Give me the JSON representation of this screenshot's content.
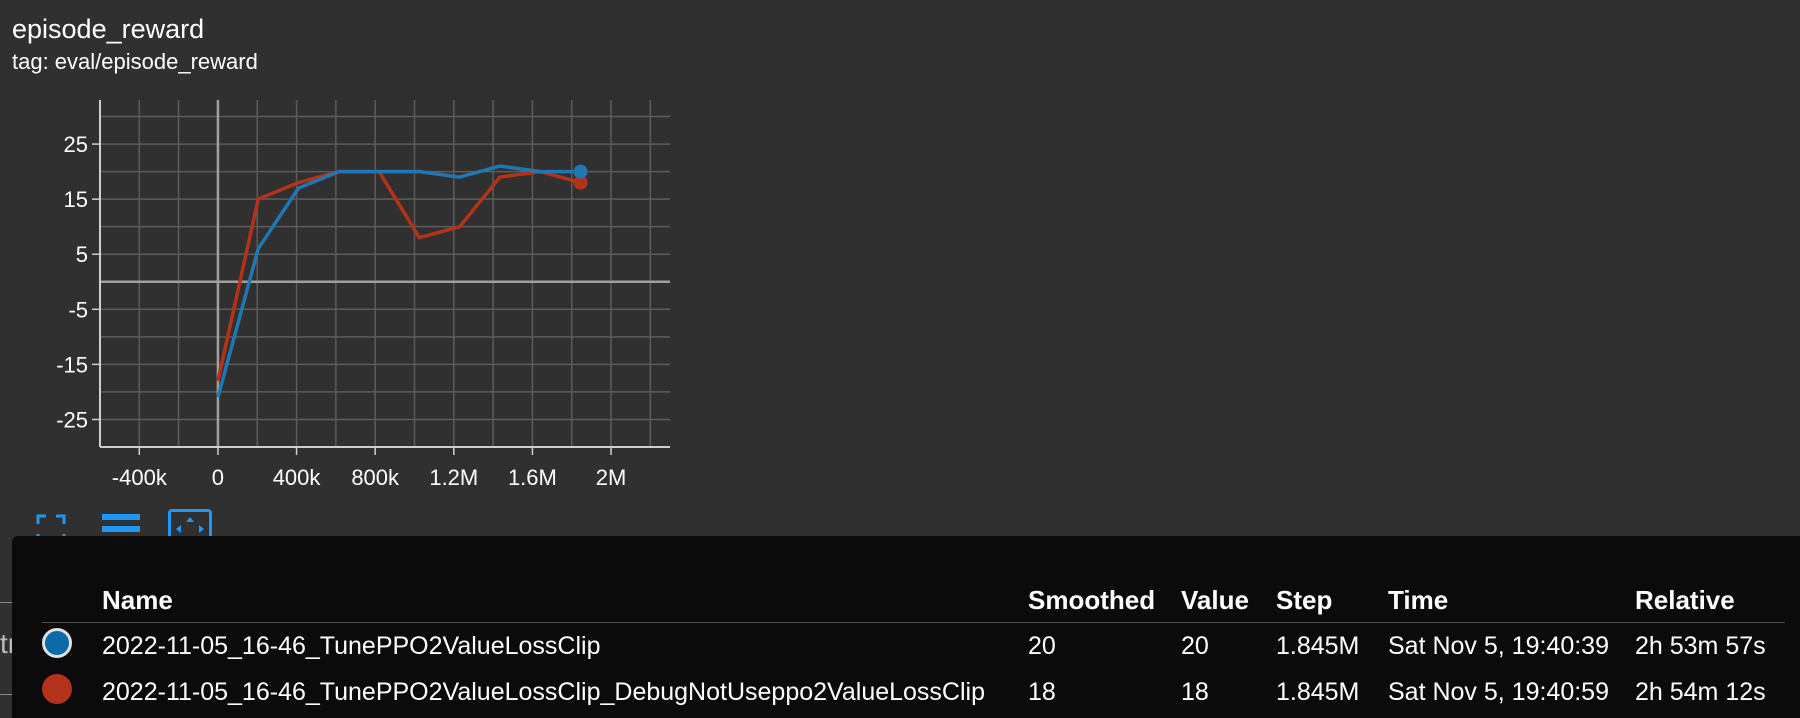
{
  "card": {
    "title": "episode_reward",
    "tag": "tag: eval/episode_reward"
  },
  "toolbar": {
    "buttons": [
      {
        "name": "fullscreen-button",
        "icon": "fullscreen-icon",
        "active": false
      },
      {
        "name": "toggle-log-scale-button",
        "icon": "lines-icon",
        "active": false
      },
      {
        "name": "fit-domain-button",
        "icon": "fit-domain-icon",
        "active": true
      }
    ]
  },
  "chart_data": {
    "type": "line",
    "title": "",
    "xlabel": "",
    "ylabel": "",
    "xlim": [
      -600000,
      2300000
    ],
    "ylim": [
      -30,
      33
    ],
    "grid": true,
    "x_ticks": [
      -400000,
      0,
      400000,
      800000,
      1200000,
      1600000,
      2000000
    ],
    "x_tick_labels": [
      "-400k",
      "0",
      "400k",
      "800k",
      "1.2M",
      "1.6M",
      "2M"
    ],
    "y_ticks": [
      -25,
      -15,
      -5,
      5,
      15,
      25
    ],
    "y_tick_labels": [
      "-25",
      "-15",
      "-5",
      "5",
      "15",
      "25"
    ],
    "series": [
      {
        "color": "#1f77b4",
        "x": [
          0,
          205000,
          410000,
          615000,
          820000,
          1025000,
          1230000,
          1435000,
          1640000,
          1845000
        ],
        "y": [
          -21,
          6,
          17,
          20,
          20,
          20,
          19,
          21,
          20,
          20
        ]
      },
      {
        "color": "#b5321a",
        "x": [
          0,
          205000,
          410000,
          615000,
          820000,
          1025000,
          1230000,
          1435000,
          1640000,
          1845000
        ],
        "y": [
          -18,
          15,
          18,
          20,
          20,
          8,
          10,
          19,
          20,
          18
        ]
      }
    ]
  },
  "tooltip": {
    "columns": [
      "Name",
      "Smoothed",
      "Value",
      "Step",
      "Time",
      "Relative"
    ],
    "rows": [
      {
        "color": "#0b6aa8",
        "name": "2022-11-05_16-46_TunePPO2ValueLossClip",
        "smoothed": "20",
        "value": "20",
        "step": "1.845M",
        "time": "Sat Nov 5, 19:40:39",
        "relative": "2h 53m 57s"
      },
      {
        "color": "#b5321a",
        "name": "2022-11-05_16-46_TunePPO2ValueLossClip_DebugNotUseppo2ValueLossClip",
        "smoothed": "18",
        "value": "18",
        "step": "1.845M",
        "time": "Sat Nov 5, 19:40:59",
        "relative": "2h 54m 12s"
      }
    ]
  },
  "sidebar_fragment": "trai"
}
